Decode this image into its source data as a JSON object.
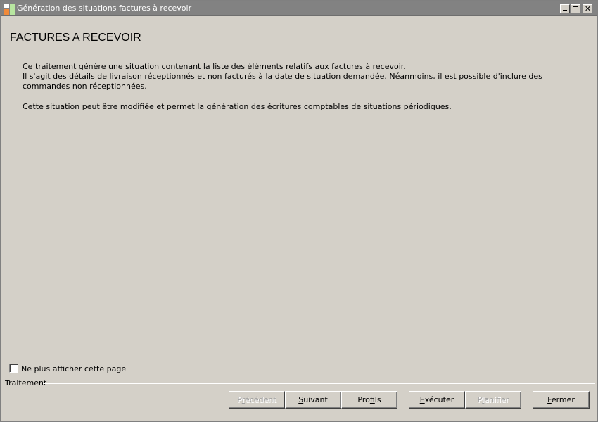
{
  "window": {
    "title": "Génération des situations factures à recevoir",
    "icon": "app-icon",
    "controls": {
      "minimize": "minimize-icon",
      "maximize": "maximize-icon",
      "close": "close-icon"
    }
  },
  "page": {
    "title": "FACTURES A RECEVOIR",
    "description": [
      "Ce traitement génère une situation contenant la liste des éléments relatifs aux factures à recevoir.",
      "Il s'agit des détails de livraison réceptionnés et non facturés à la date de situation demandée. Néanmoins, il est possible d'inclure des",
      "commandes non réceptionnées.",
      "Cette situation peut être modifiée et permet la génération des écritures comptables de situations périodiques."
    ]
  },
  "options": {
    "hide_page_label": "Ne plus afficher cette page",
    "hide_page_checked": false
  },
  "footer": {
    "group_label": "Traitement",
    "buttons": {
      "previous": {
        "first": "P",
        "accel": "r",
        "rest": "écédent",
        "enabled": false
      },
      "next": {
        "first": "",
        "accel": "S",
        "rest": "uivant",
        "enabled": true
      },
      "profiles": {
        "first": "Pro",
        "accel": "f",
        "rest": "ils",
        "enabled": true
      },
      "execute": {
        "first": "",
        "accel": "E",
        "rest": "xécuter",
        "enabled": true
      },
      "schedule": {
        "first": "P",
        "accel": "l",
        "rest": "anifier",
        "enabled": false
      },
      "close": {
        "first": "",
        "accel": "F",
        "rest": "ermer",
        "enabled": true
      }
    }
  },
  "colors": {
    "window_bg": "#d4d0c8",
    "titlebar_bg": "#828282",
    "titlebar_text": "#ffffff",
    "disabled_text": "#a0a0a0"
  }
}
